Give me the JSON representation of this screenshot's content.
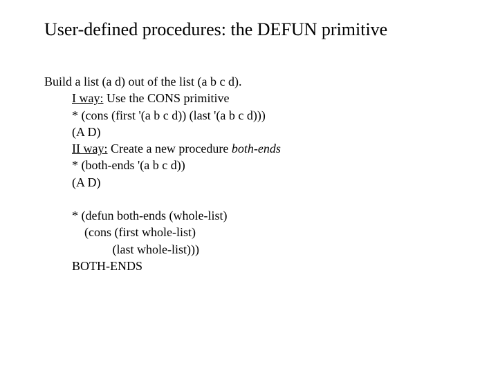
{
  "title": "User-defined procedures: the DEFUN primitive",
  "line_intro": "Build a list (a d) out of the list (a b c d).",
  "way1_label": "I way:",
  "way1_text": " Use the CONS primitive",
  "way1_code1": "* (cons (first '(a b c d)) (last '(a b c d)))",
  "way1_code2": "(A D)",
  "way2_label": "II way:",
  "way2_text_a": " Create a new procedure ",
  "way2_text_b": "both-ends",
  "way2_code1": "* (both-ends '(a b c d))",
  "way2_code2": "(A D)",
  "defun_l1": "* (defun both-ends (whole-list)",
  "defun_l2": "    (cons (first whole-list)",
  "defun_l3": "             (last whole-list)))",
  "defun_l4": "BOTH-ENDS"
}
